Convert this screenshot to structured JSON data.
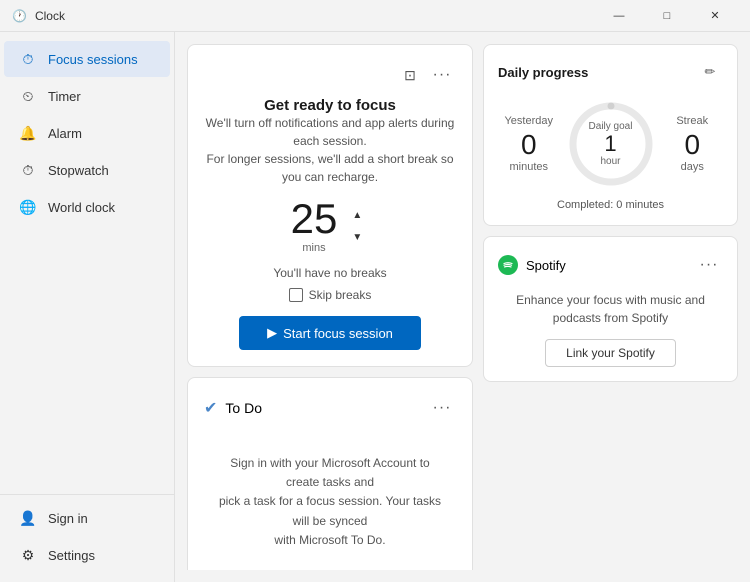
{
  "titlebar": {
    "app_name": "Clock",
    "min_btn": "—",
    "max_btn": "□",
    "close_btn": "✕"
  },
  "sidebar": {
    "items": [
      {
        "id": "focus-sessions",
        "label": "Focus sessions",
        "icon": "⏱",
        "active": true
      },
      {
        "id": "timer",
        "label": "Timer",
        "icon": "⏲"
      },
      {
        "id": "alarm",
        "label": "Alarm",
        "icon": "🔔"
      },
      {
        "id": "stopwatch",
        "label": "Stopwatch",
        "icon": "⏱"
      },
      {
        "id": "world-clock",
        "label": "World clock",
        "icon": "🌐"
      }
    ],
    "bottom_items": [
      {
        "id": "sign-in",
        "label": "Sign in",
        "icon": "👤"
      },
      {
        "id": "settings",
        "label": "Settings",
        "icon": "⚙"
      }
    ]
  },
  "focus": {
    "title": "Get ready to focus",
    "subtitle": "We'll turn off notifications and app alerts during each session.\nFor longer sessions, we'll add a short break so you can recharge.",
    "timer_value": "25",
    "timer_unit": "mins",
    "no_breaks_text": "You'll have no breaks",
    "skip_breaks_label": "Skip breaks",
    "start_btn_label": "Start focus session",
    "start_icon": "▶"
  },
  "todo": {
    "title": "To Do",
    "body": "Sign in with your Microsoft Account to create tasks and\npick a task for a focus session. Your tasks will be synced\nwith Microsoft To Do."
  },
  "daily_progress": {
    "title": "Daily progress",
    "yesterday_label": "Yesterday",
    "yesterday_value": "0",
    "yesterday_unit": "minutes",
    "daily_goal_label": "Daily goal",
    "daily_goal_value": "1",
    "daily_goal_unit": "hour",
    "streak_label": "Streak",
    "streak_value": "0",
    "streak_unit": "days",
    "completed_text": "Completed: 0 minutes"
  },
  "spotify": {
    "name": "Spotify",
    "desc": "Enhance your focus with music and podcasts from\nSpotify",
    "link_btn_label": "Link your Spotify"
  }
}
